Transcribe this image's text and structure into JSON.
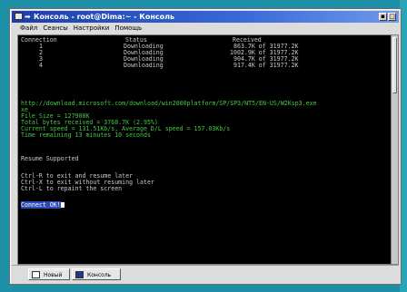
{
  "window": {
    "title": "Консоль - root@Dima:~ - Консоль",
    "menu": [
      "Файл",
      "Сеансы",
      "Настройки",
      "Помощь"
    ]
  },
  "terminal": {
    "headers": {
      "connection": "Connection",
      "status": "Status",
      "received": "Received"
    },
    "rows": [
      {
        "id": "1",
        "status": "Downloading",
        "received": "863.7K of 31977.2K"
      },
      {
        "id": "2",
        "status": "Downloading",
        "received": "1002.9K of 31977.2K"
      },
      {
        "id": "3",
        "status": "Downloading",
        "received": "904.7K of 31977.2K"
      },
      {
        "id": "4",
        "status": "Downloading",
        "received": "917.4K of 31977.2K"
      }
    ],
    "url_line1": "http://download.microsoft.com/download/win2000platform/SP/SP3/NT5/EN-US/W2Ksp3.exe",
    "url_line2": "xe",
    "file_size": "File Size = 127908K",
    "total_bytes": "Total bytes received = 3768.7K (2.95%)",
    "speed": "Current speed = 131.51Kb/s, Average D/L speed = 157.03Kb/s",
    "time_remaining": "Time remaining 13 minutes 10 seconds",
    "resume": "Resume Supported",
    "help1": "Ctrl-R to exit and resume later",
    "help2": "Ctrl-X to exit without resuming later",
    "help3": "Ctrl-L to repaint the screen",
    "connect_status": "Connect OK!"
  },
  "taskbar": {
    "tab_new": "Новый",
    "tab_console": "Консоль"
  },
  "colors": {
    "desktop": "#1d8fa6",
    "titlebar": "#1c3da8",
    "terminal_bg": "#000000",
    "terminal_green": "#46c846"
  }
}
